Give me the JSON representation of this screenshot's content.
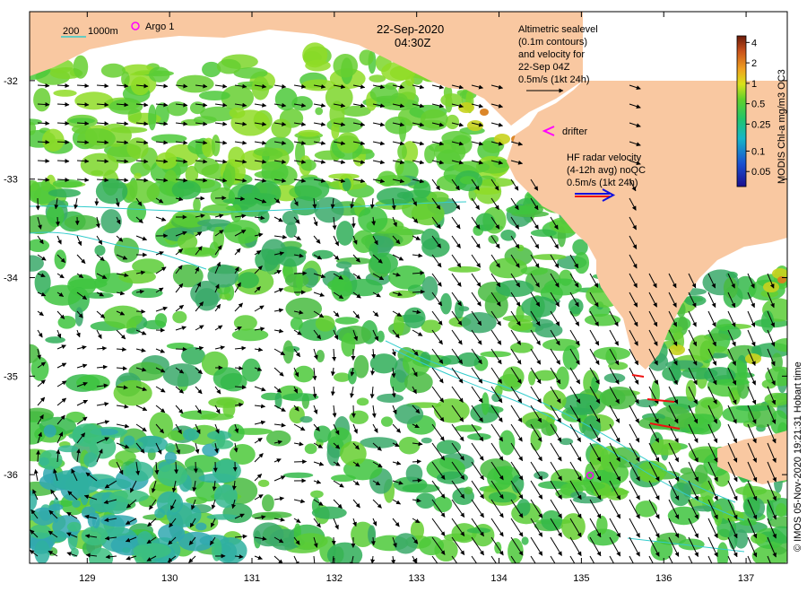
{
  "title": {
    "date": "22-Sep-2020",
    "time": "04:30Z"
  },
  "legend": {
    "isobath_a": "200",
    "isobath_b": "1000m",
    "argo_label": "Argo 1",
    "altimetric_lines": [
      "Altimetric sealevel",
      "(0.1m contours)",
      "and velocity for",
      "22-Sep 04Z",
      "0.5m/s (1kt 24h)"
    ],
    "drifter_label": "drifter",
    "hf_lines": [
      "HF radar velocity",
      "(4-12h avg) noQC",
      "0.5m/s (1kt 24h)"
    ]
  },
  "colorbar": {
    "title": "MODIS Chl-a mg/m3 OC3",
    "ticks": [
      "4",
      "2",
      "1",
      "0.5",
      "0.25",
      "0.1",
      "0.05"
    ],
    "tick_values": [
      4,
      2,
      1,
      0.5,
      0.25,
      0.1,
      0.05
    ],
    "range": [
      0.03,
      5
    ],
    "scale": "log"
  },
  "axes": {
    "x_ticks": [
      "129",
      "130",
      "131",
      "132",
      "133",
      "134",
      "135",
      "136",
      "137"
    ],
    "x_values": [
      129,
      130,
      131,
      132,
      133,
      134,
      135,
      136,
      137
    ],
    "y_ticks": [
      "-32",
      "-33",
      "-34",
      "-35",
      "-36"
    ],
    "y_values": [
      -32,
      -33,
      -34,
      -35,
      -36
    ]
  },
  "credit": "© IMOS 05-Nov-2020 19:21:31 Hobart time",
  "colors": {
    "land": "#f9c8a1",
    "frame": "#000000",
    "argo": "#ff00ff",
    "drifter": "#ff00ff",
    "hf_arrow": "#1111dd",
    "hf_arrow_red": "#ee1111",
    "isobath": "#33cccc"
  }
}
